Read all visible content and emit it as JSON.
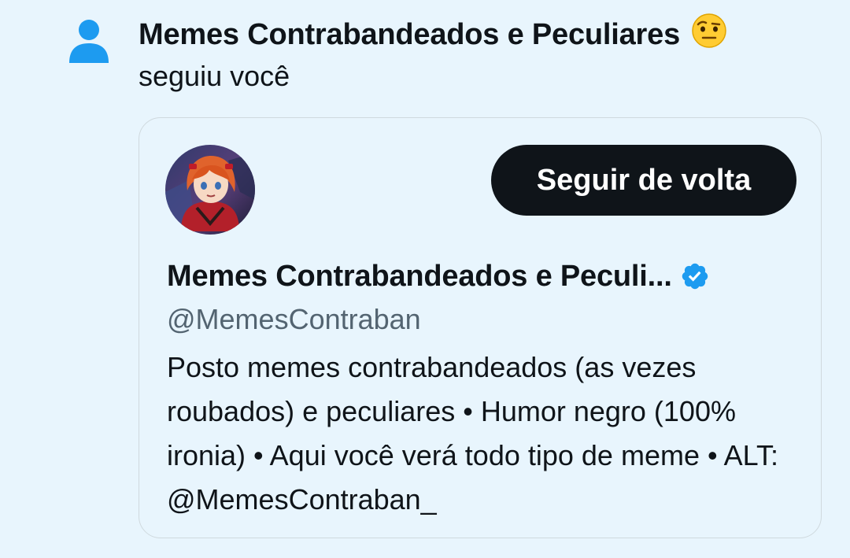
{
  "notification": {
    "icon": "person-icon",
    "title": "Memes Contrabandeados e Peculiares",
    "title_emoji": "raised-eyebrow-emoji",
    "subtitle": "seguiu você"
  },
  "profile_card": {
    "avatar": "profile-avatar",
    "follow_button_label": "Seguir de volta",
    "display_name": "Memes Contrabandeados e Peculi...",
    "verified_icon": "verified-badge-icon",
    "handle": "@MemesContraban",
    "bio": "Posto memes contrabandeados (as vezes roubados) e peculiares • Humor negro (100% ironia) • Aqui você verá todo tipo de meme • ALT: @MemesContraban_"
  },
  "colors": {
    "background": "#e8f5fd",
    "accent": "#1d9bf0",
    "button": "#0f1419",
    "secondary_text": "#536471",
    "card_border": "#cfd9de"
  }
}
